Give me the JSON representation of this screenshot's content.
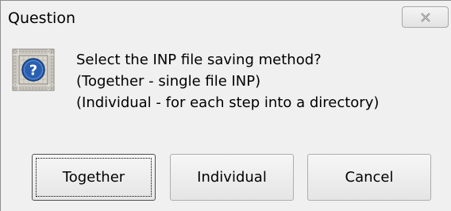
{
  "window": {
    "title": "Question",
    "close_icon": "close-x-icon"
  },
  "message": {
    "icon": "question-icon",
    "lines": [
      "Select the INP file saving method?",
      "(Together - single file INP)",
      "(Individual - for each step into a directory)"
    ]
  },
  "buttons": {
    "together": "Together",
    "individual": "Individual",
    "cancel": "Cancel"
  },
  "colors": {
    "dialog_background": "#f0f0f0",
    "question_blue": "#2a5fb0"
  }
}
